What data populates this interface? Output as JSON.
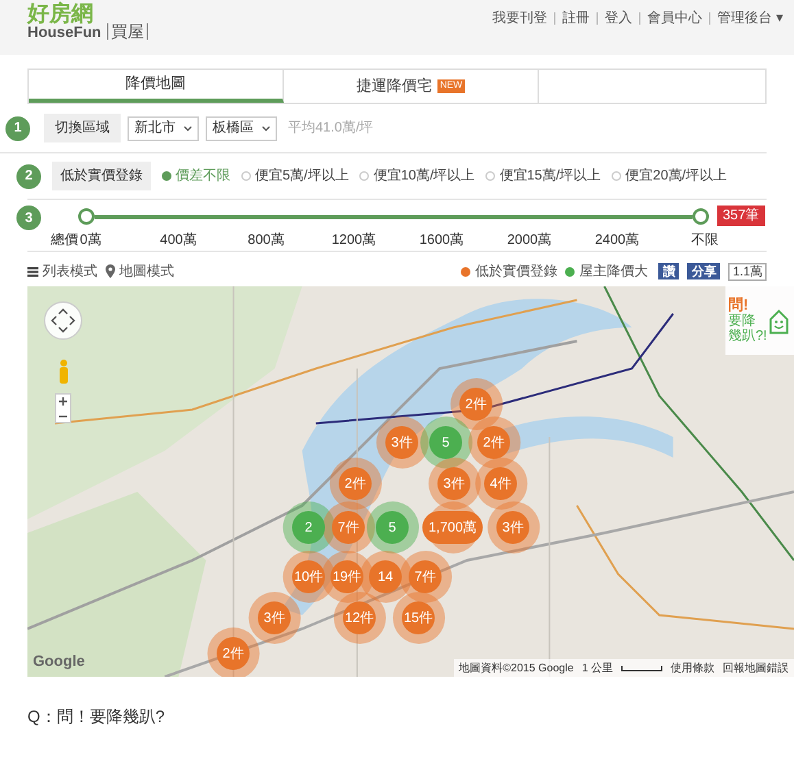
{
  "header": {
    "logo_cn": "好房網",
    "logo_en": "HouseFun",
    "section": "買屋",
    "nav": [
      "我要刊登",
      "註冊",
      "登入",
      "會員中心",
      "管理後台 ▾"
    ]
  },
  "tabs": [
    {
      "label": "降價地圖",
      "selected": true
    },
    {
      "label": "捷運降價宅",
      "selected": false,
      "badge": "NEW"
    }
  ],
  "steps": [
    {
      "number": "1",
      "label": "切換區域"
    },
    {
      "number": "2",
      "label": "低於實價登錄"
    },
    {
      "number": "3"
    }
  ],
  "region": {
    "city": "新北市",
    "district": "板橋區",
    "average": "平均41.0萬/坪"
  },
  "price_filters": [
    {
      "label": "價差不限",
      "selected": true
    },
    {
      "label": "便宜5萬/坪以上",
      "selected": false
    },
    {
      "label": "便宜10萬/坪以上",
      "selected": false
    },
    {
      "label": "便宜15萬/坪以上",
      "selected": false
    },
    {
      "label": "便宜20萬/坪以上",
      "selected": false
    }
  ],
  "price_slider": {
    "axis_label": "總價",
    "level": 1,
    "count": "357筆",
    "ticks": [
      "0萬",
      "400萬",
      "800萬",
      "1200萬",
      "1600萬",
      "2000萬",
      "2400萬",
      "不限"
    ]
  },
  "view_modes": [
    {
      "label": "列表模式",
      "kind": "list"
    },
    {
      "label": "地圖模式",
      "kind": "map"
    }
  ],
  "legend": [
    {
      "label": "低於實價登錄",
      "color": "#e8742a"
    },
    {
      "label": "屋主降價大",
      "color": "#4caf50"
    }
  ],
  "social": {
    "like": "讚",
    "share": "分享",
    "count": "1.1萬"
  },
  "map": {
    "promo": {
      "title": "問!",
      "line_1": "要降",
      "line_2": "幾趴?!"
    },
    "clusters": [
      {
        "label": "2件",
        "kind": "low"
      },
      {
        "label": "3件",
        "kind": "low"
      },
      {
        "label": "5",
        "kind": "owner"
      },
      {
        "label": "2件",
        "kind": "low"
      },
      {
        "label": "2件",
        "kind": "low"
      },
      {
        "label": "3件",
        "kind": "low"
      },
      {
        "label": "4件",
        "kind": "low"
      },
      {
        "label": "2",
        "kind": "owner"
      },
      {
        "label": "7件",
        "kind": "low"
      },
      {
        "label": "5",
        "kind": "owner"
      },
      {
        "label": "1,700萬",
        "kind": "low"
      },
      {
        "label": "3件",
        "kind": "low"
      },
      {
        "label": "10件",
        "kind": "low"
      },
      {
        "label": "19件",
        "kind": "low"
      },
      {
        "label": "14",
        "kind": "low"
      },
      {
        "label": "7件",
        "kind": "low"
      },
      {
        "label": "3件",
        "kind": "low"
      },
      {
        "label": "12件",
        "kind": "low"
      },
      {
        "label": "15件",
        "kind": "low"
      },
      {
        "label": "2件",
        "kind": "low"
      }
    ],
    "google": "Google",
    "attribution": "地圖資料©2015 Google",
    "scale": "1 公里",
    "terms": "使用條款",
    "report": "回報地圖錯誤"
  },
  "question": "Q：問！要降幾趴?"
}
